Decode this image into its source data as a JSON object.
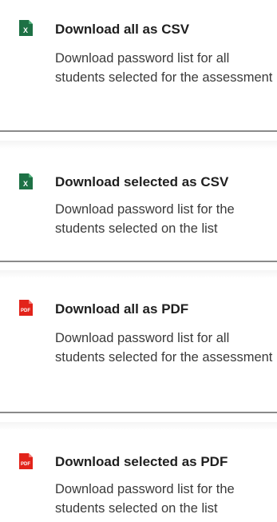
{
  "menu": {
    "items": [
      {
        "title": "Download all as CSV",
        "description": "Download password list for all students selected for the assessment",
        "icon": "excel-file-icon",
        "icon_label": "X",
        "icon_color": "#1e7145"
      },
      {
        "title": "Download selected as CSV",
        "description": "Download password list for the students selected on the list",
        "icon": "excel-file-icon",
        "icon_label": "X",
        "icon_color": "#1e7145"
      },
      {
        "title": "Download all as PDF",
        "description": "Download password list for all students selected for the assessment",
        "icon": "pdf-file-icon",
        "icon_label": "PDF",
        "icon_color": "#e2231a"
      },
      {
        "title": "Download selected as PDF",
        "description": "Download password list for the students selected on the list",
        "icon": "pdf-file-icon",
        "icon_label": "PDF",
        "icon_color": "#e2231a"
      }
    ]
  }
}
